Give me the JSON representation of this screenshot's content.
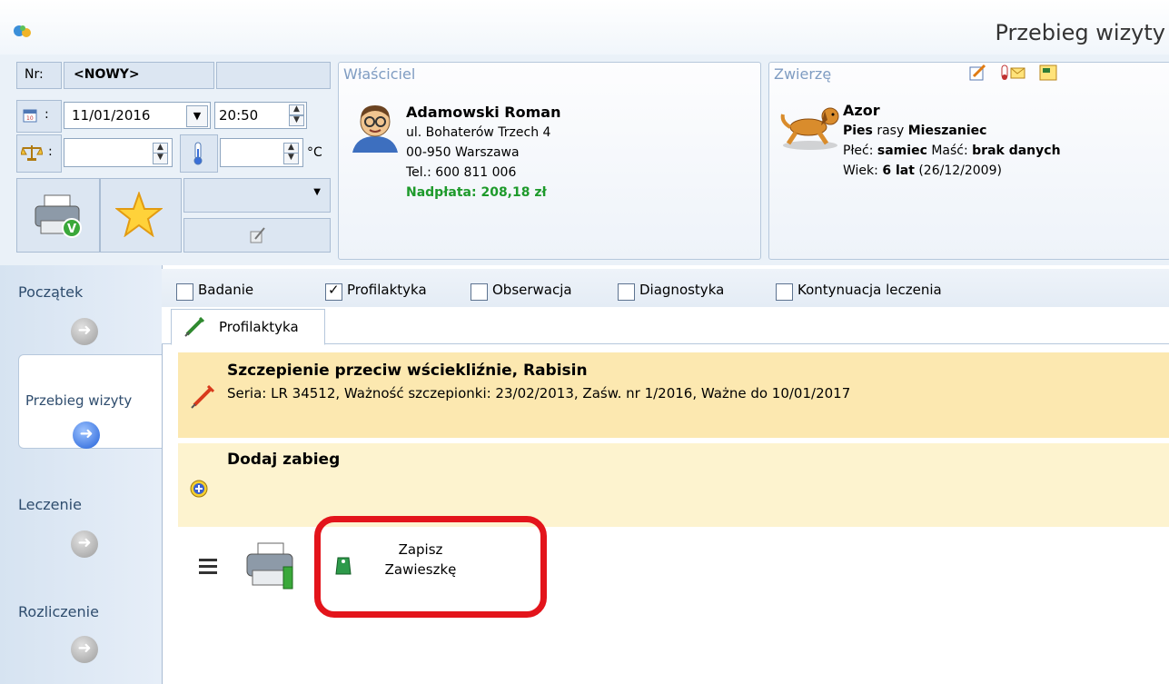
{
  "window": {
    "title": "Przebieg wizyty"
  },
  "visit": {
    "nr_label": "Nr:",
    "nr_value": "<NOWY>",
    "date_sep": ":",
    "date": "11/01/2016",
    "time": "20:50",
    "weight_sep": ":",
    "temp_unit": "°C"
  },
  "owner": {
    "section_title": "Właściciel",
    "name": "Adamowski Roman",
    "street": "ul. Bohaterów Trzech 4",
    "city": "00-950  Warszawa",
    "phone": "Tel.: 600 811 006",
    "balance": "Nadpłata: 208,18 zł",
    "balance_color": "#1e9a2b"
  },
  "animal": {
    "section_title": "Zwierzę",
    "name": "Azor",
    "species": "Pies",
    "breed_word": "rasy",
    "breed": "Mieszaniec",
    "sex_label": "Płeć:",
    "sex": "samiec",
    "color_label": "Maść:",
    "color": "brak danych",
    "age_label": "Wiek:",
    "age": "6 lat",
    "birth": "(26/12/2009)"
  },
  "nav": {
    "items": [
      {
        "label": "Początek"
      },
      {
        "label": "Przebieg wizyty"
      },
      {
        "label": "Leczenie"
      },
      {
        "label": "Rozliczenie"
      }
    ]
  },
  "checks": [
    {
      "label": "Badanie",
      "checked": false
    },
    {
      "label": "Profilaktyka",
      "checked": true
    },
    {
      "label": "Obserwacja",
      "checked": false
    },
    {
      "label": "Diagnostyka",
      "checked": false
    },
    {
      "label": "Kontynuacja leczenia",
      "checked": false
    }
  ],
  "tab": {
    "label": "Profilaktyka"
  },
  "vaccination": {
    "title": "Szczepienie przeciw wściekliźnie, Rabisin",
    "details": "Seria: LR 34512, Ważność szczepionki: 23/02/2013, Zaśw. nr 1/2016, Ważne do 10/01/2017"
  },
  "add": {
    "label": "Dodaj zabieg"
  },
  "actions": {
    "save_line1": "Zapisz",
    "save_line2": "Zawieszkę",
    "highlight_color": "#e3141b"
  },
  "icons": [
    "app-icon",
    "calendar-icon",
    "scale-icon",
    "thermometer-icon",
    "print-icon",
    "star-icon",
    "edit-icon",
    "owner-avatar-icon",
    "dog-icon",
    "syringe-icon",
    "plus-icon",
    "menu-icon",
    "tag-icon"
  ]
}
